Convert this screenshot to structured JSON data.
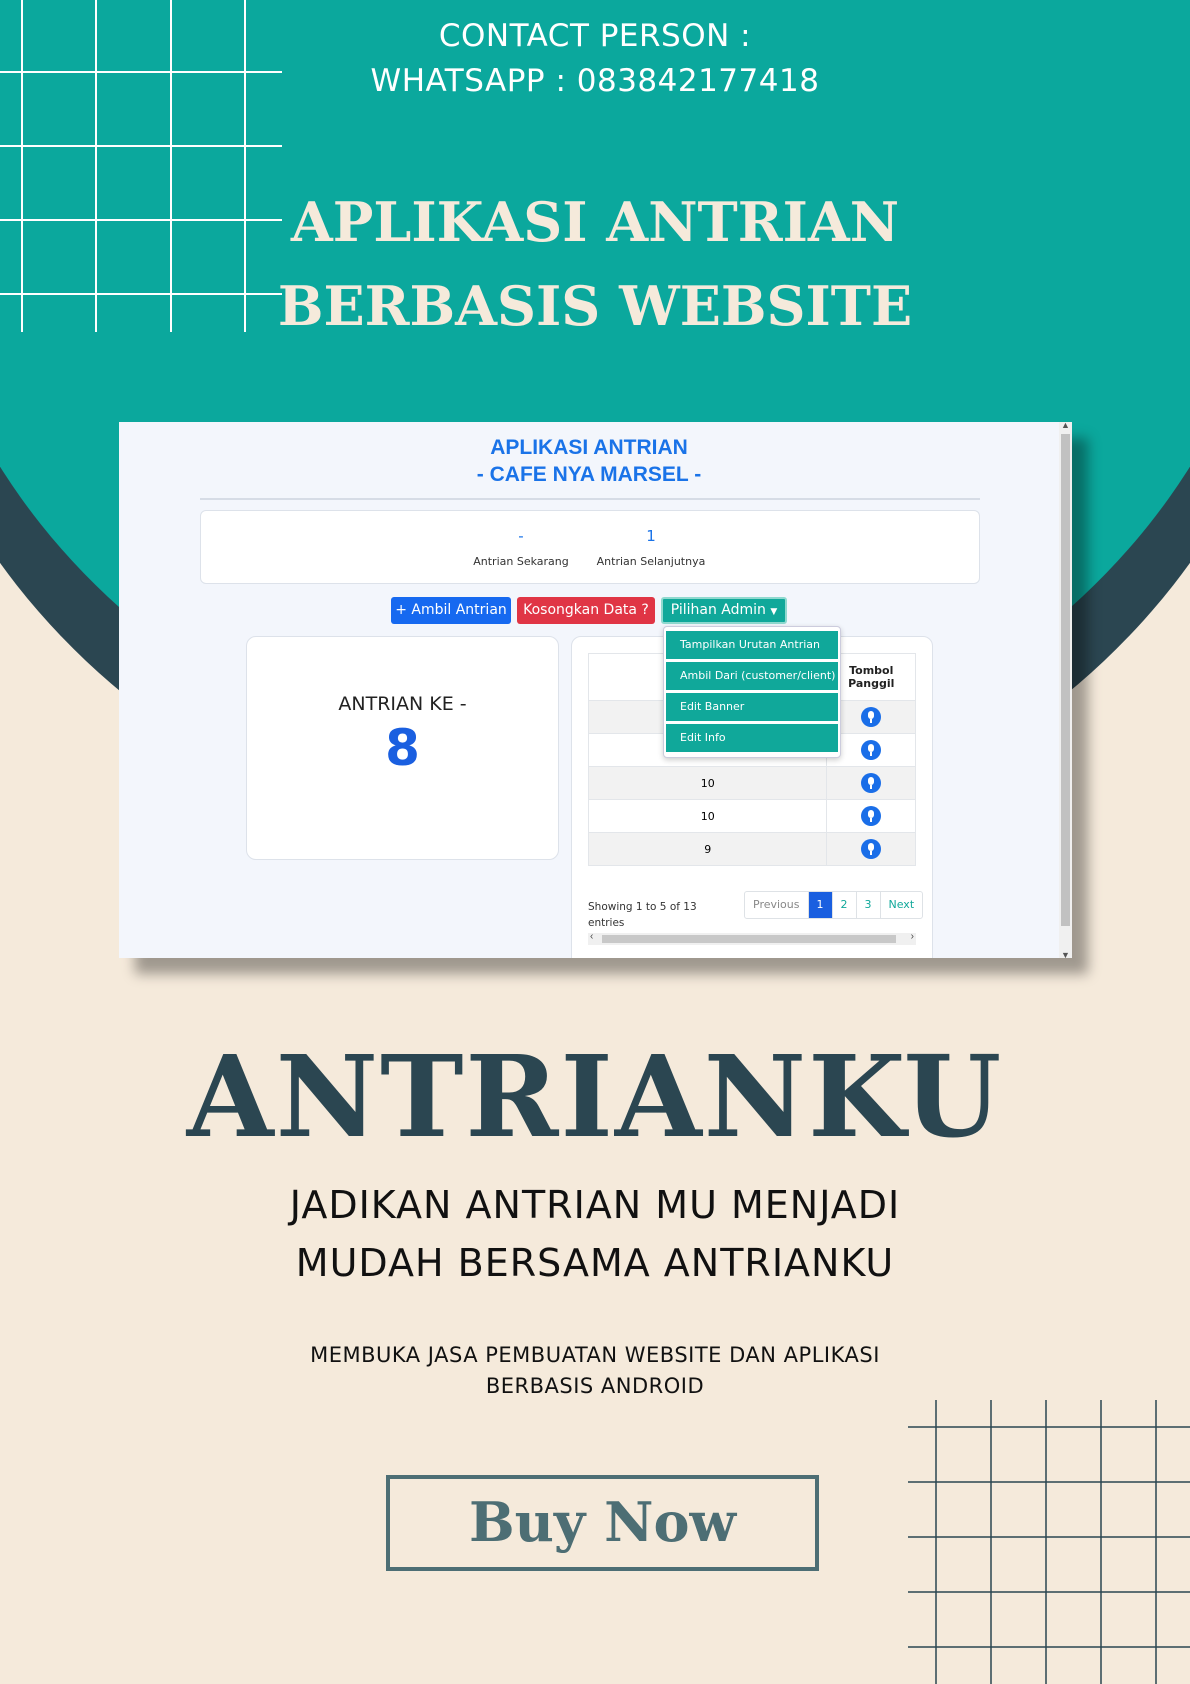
{
  "colors": {
    "teal": "#0ba89d",
    "dark_ring": "#2b4651",
    "cream": "#f5eadb",
    "brand_text": "#2b4651"
  },
  "contact": {
    "line1": "CONTACT PERSON :",
    "line2": "WHATSAPP : 083842177418"
  },
  "headline": {
    "line1": "APLIKASI ANTRIAN",
    "line2": "BERBASIS WEBSITE"
  },
  "app": {
    "title_line1": "APLIKASI ANTRIAN",
    "title_line2": "- CAFE NYA MARSEL -",
    "current_value": "-",
    "current_label": "Antrian Sekarang",
    "next_value": "1",
    "next_label": "Antrian Selanjutnya",
    "buttons": {
      "take": "+ Ambil Antrian",
      "clear": "Kosongkan Data ?",
      "admin": "Pilihan Admin"
    },
    "dropdown_items": [
      "Tampilkan Urutan Antrian",
      "Ambil Dari (customer/client)",
      "Edit Banner",
      "Edit Info"
    ],
    "queue_label": "ANTRIAN KE -",
    "queue_number": "8",
    "table_header_call": "Tombol Panggil",
    "table_rows": [
      "",
      "",
      "10",
      "10",
      "9"
    ],
    "showing": "Showing 1 to 5 of 13 entries",
    "pager": {
      "prev": "Previous",
      "pages": [
        "1",
        "2",
        "3"
      ],
      "next": "Next"
    }
  },
  "brand": "ANTRIANKU",
  "tagline": {
    "line1": "JADIKAN ANTRIAN MU MENJADI",
    "line2": "MUDAH BERSAMA ANTRIANKU"
  },
  "service": {
    "line1": "MEMBUKA JASA PEMBUATAN WEBSITE DAN APLIKASI",
    "line2": "BERBASIS ANDROID"
  },
  "buy_button": "Buy Now"
}
